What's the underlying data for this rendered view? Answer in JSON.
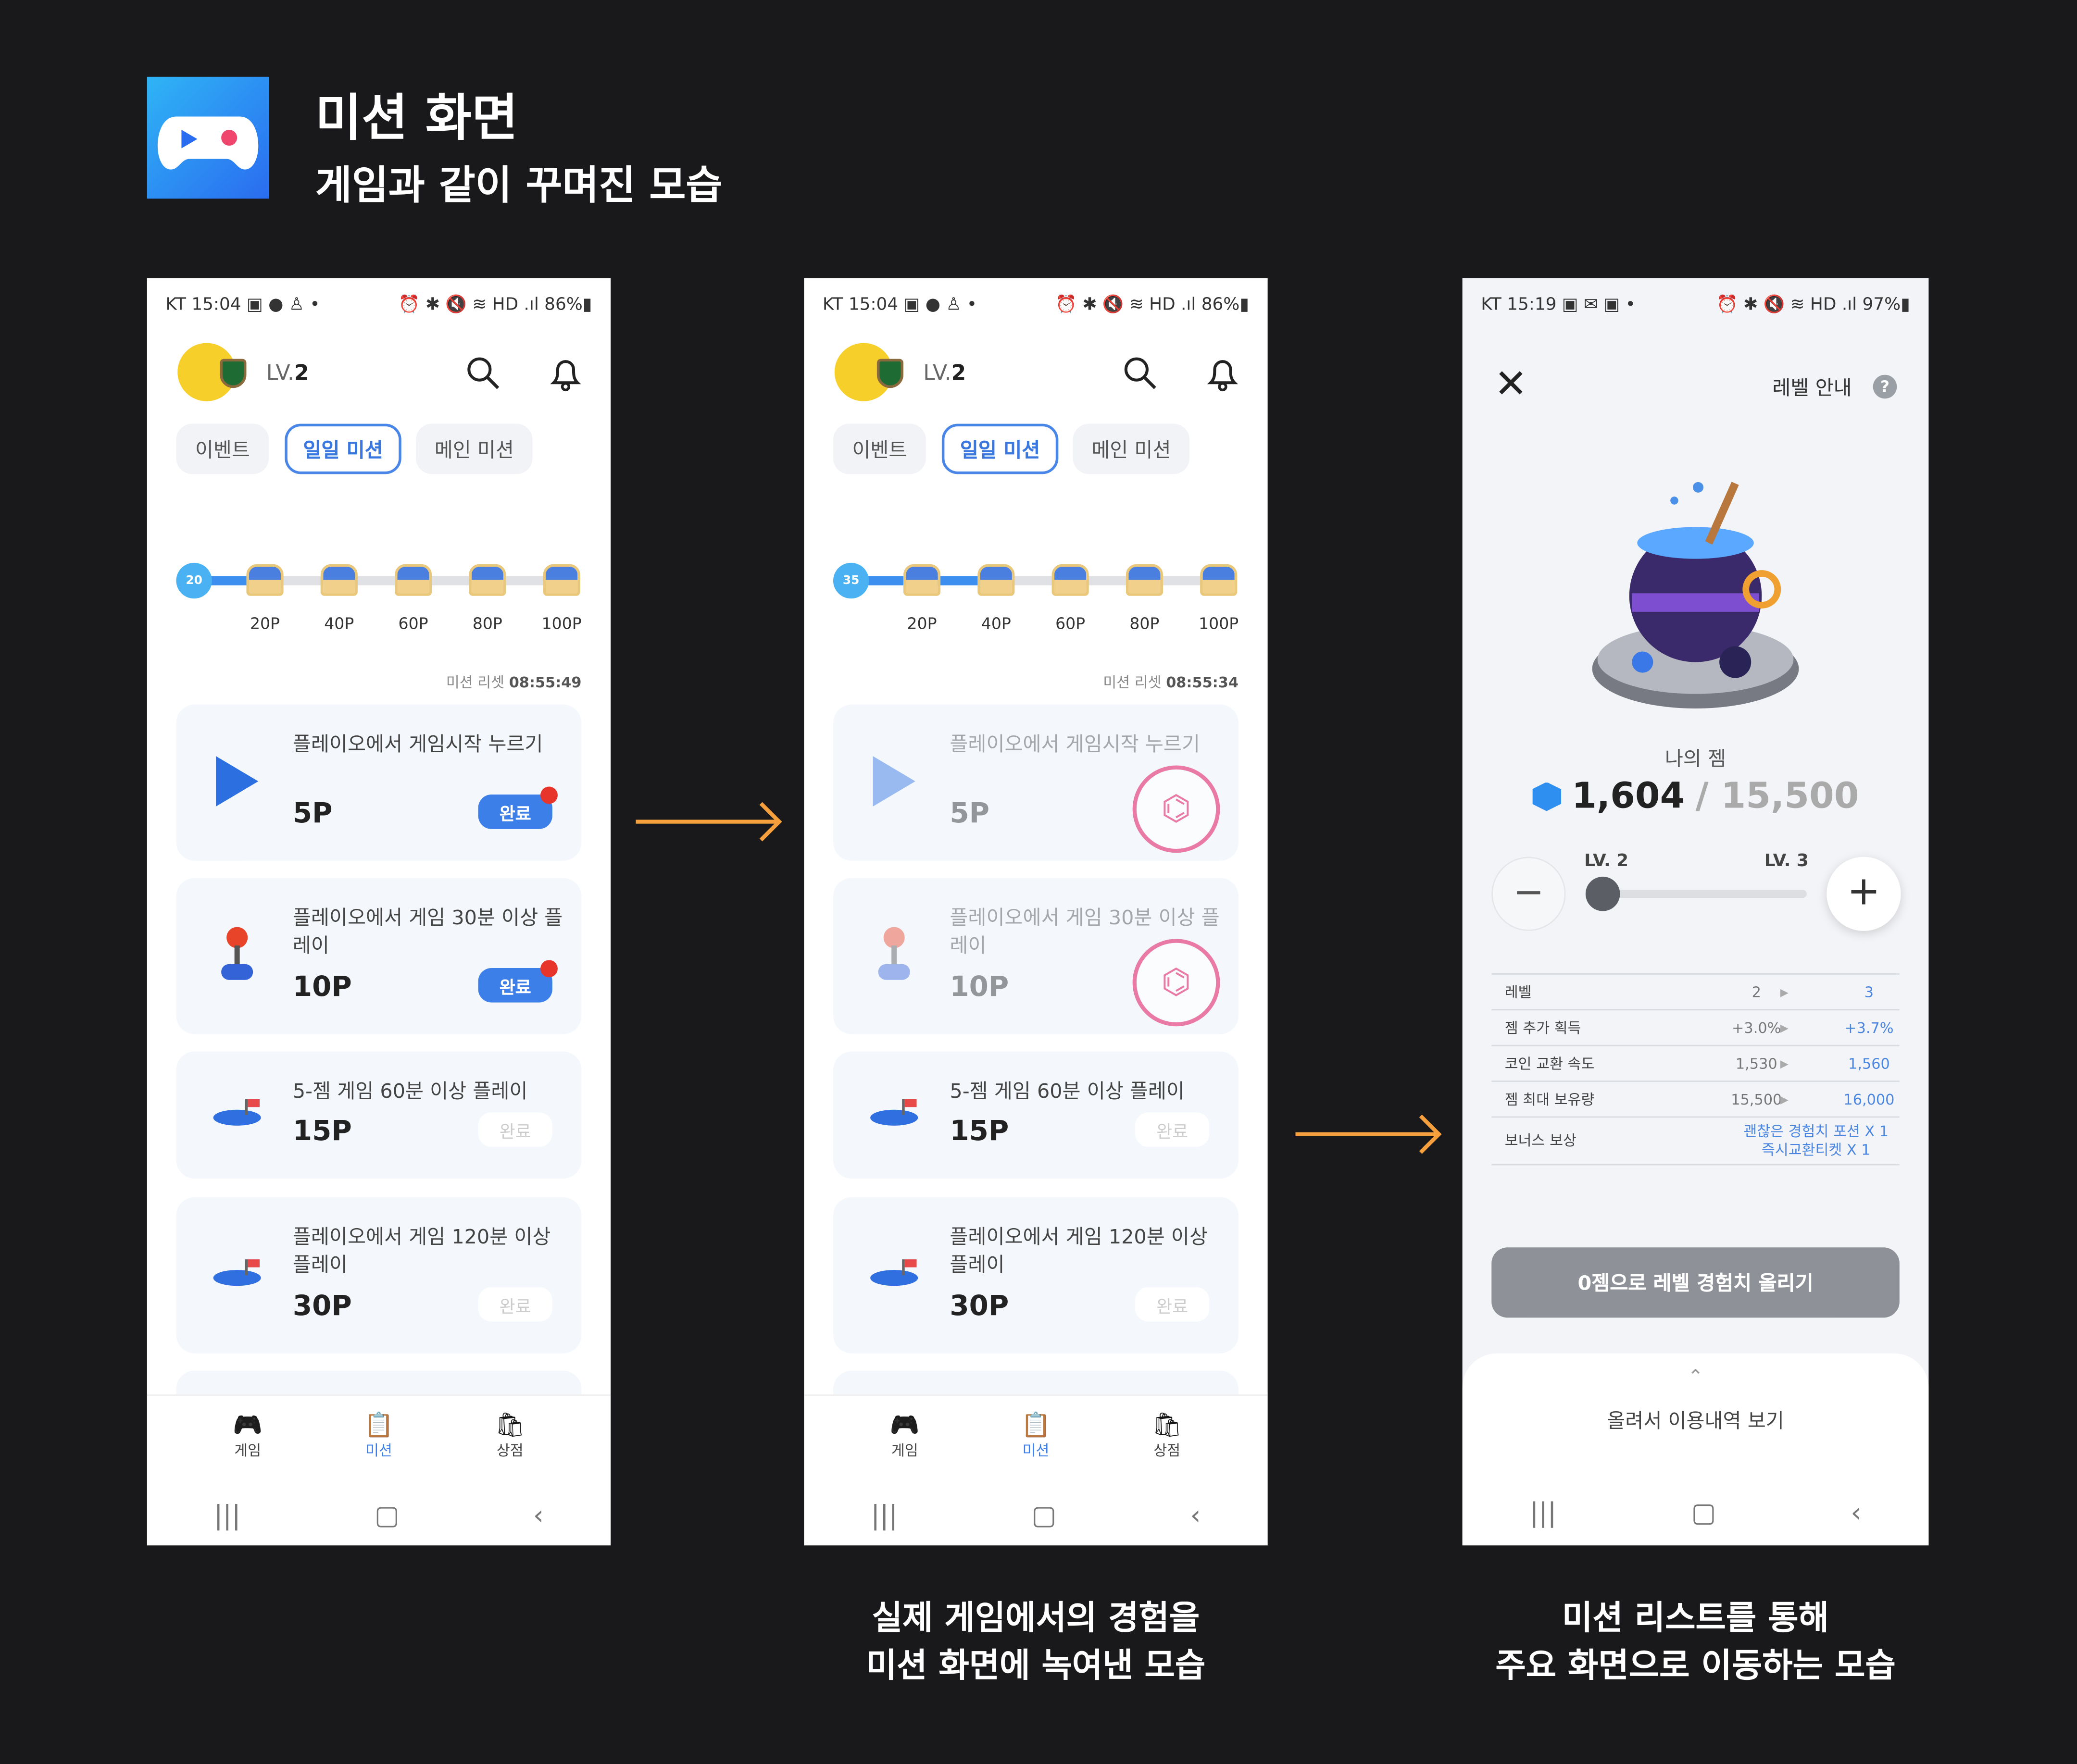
{
  "header": {
    "title": "미션 화면",
    "subtitle": "게임과 같이 꾸며진 모습",
    "logo_icon": "gamepad-icon"
  },
  "captions": {
    "phone2": [
      "실제 게임에서의 경험을",
      "미션 화면에 녹여낸 모습"
    ],
    "phone3": [
      "미션 리스트를 통해",
      "주요 화면으로 이동하는 모습"
    ]
  },
  "colors": {
    "accent": "#3d7fe8",
    "arrow": "#f5a03c",
    "badge": "#e8352c",
    "stamp": "#e87aa5"
  },
  "mission_screens": [
    {
      "status": {
        "left": "KT 15:04 ▣ ● ♙ •",
        "right": "⏰ ✱ 🔇 ≋ HD .ıl 86%▮"
      },
      "level": "LV.",
      "level_num": "2",
      "tabs": [
        "이벤트",
        "일일 미션",
        "메인 미션"
      ],
      "active_tab": 1,
      "progress_points": 20,
      "milestones": [
        "20P",
        "40P",
        "60P",
        "80P",
        "100P"
      ],
      "reset_label": "미션 리셋",
      "reset_time": "08:55:49",
      "missions": [
        {
          "title": "플레이오에서 게임시작 누르기",
          "points": "5P",
          "button": "완료",
          "state": "claimable",
          "icon": "play-icon"
        },
        {
          "title": "플레이오에서 게임 30분 이상 플레이",
          "points": "10P",
          "button": "완료",
          "state": "claimable",
          "icon": "joystick-icon"
        },
        {
          "title": "5-젬 게임 60분 이상 플레이",
          "points": "15P",
          "button": "완료",
          "state": "locked",
          "icon": "gem-pile-icon"
        },
        {
          "title": "플레이오에서 게임 120분 이상 플레이",
          "points": "30P",
          "button": "완료",
          "state": "locked",
          "icon": "gem-pile-icon"
        }
      ],
      "nav": [
        "게임",
        "미션",
        "상점"
      ],
      "active_nav": 1
    },
    {
      "status": {
        "left": "KT 15:04 ▣ ● ♙ •",
        "right": "⏰ ✱ 🔇 ≋ HD .ıl 86%▮"
      },
      "level": "LV.",
      "level_num": "2",
      "tabs": [
        "이벤트",
        "일일 미션",
        "메인 미션"
      ],
      "active_tab": 1,
      "progress_points": 35,
      "milestones": [
        "20P",
        "40P",
        "60P",
        "80P",
        "100P"
      ],
      "reset_label": "미션 리셋",
      "reset_time": "08:55:34",
      "missions": [
        {
          "title": "플레이오에서 게임시작 누르기",
          "points": "5P",
          "button": "",
          "state": "claimed",
          "icon": "play-icon"
        },
        {
          "title": "플레이오에서 게임 30분 이상 플레이",
          "points": "10P",
          "button": "",
          "state": "claimed",
          "icon": "joystick-icon"
        },
        {
          "title": "5-젬 게임 60분 이상 플레이",
          "points": "15P",
          "button": "완료",
          "state": "locked",
          "icon": "gem-pile-icon"
        },
        {
          "title": "플레이오에서 게임 120분 이상 플레이",
          "points": "30P",
          "button": "완료",
          "state": "locked",
          "icon": "gem-pile-icon"
        }
      ],
      "nav": [
        "게임",
        "미션",
        "상점"
      ],
      "active_nav": 1
    }
  ],
  "level_screen": {
    "status": {
      "left": "KT 15:19 ▣ ✉ ▣ •",
      "right": "⏰ ✱ 🔇 ≋ HD .ıl 97%▮"
    },
    "guide": "레벨 안내",
    "my_gem_label": "나의 젬",
    "gems": "1,604",
    "gem_max": "/ 15,500",
    "slider_from": "LV. 2",
    "slider_to": "LV. 3",
    "slider_progress": 0,
    "table": [
      [
        "레벨",
        "2",
        "3"
      ],
      [
        "젬 추가 획득",
        "+3.0%",
        "+3.7%"
      ],
      [
        "코인 교환 속도",
        "1,530",
        "1,560"
      ],
      [
        "젬 최대 보유량",
        "15,500",
        "16,000"
      ]
    ],
    "bonus_label": "보너스 보상",
    "bonus": [
      "괜찮은 경험치 포션 X 1",
      "즉시교환티켓 X 1"
    ],
    "button": "0젬으로 레벨 경험치 올리기",
    "sheet": "올려서 이용내역 보기"
  }
}
